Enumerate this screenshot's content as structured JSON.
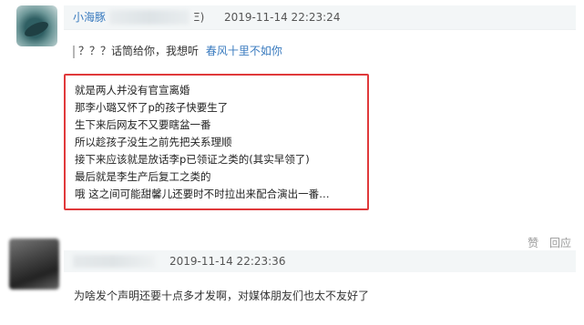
{
  "comment1": {
    "username": "小海豚",
    "username_suffix": "Ξ)",
    "timestamp": "2019-11-14 22:23:24",
    "reply_text": "？？？话筒给你，我想听",
    "reply_link": "春风十里不如你",
    "quote_lines": [
      "就是两人并没有官宣离婚",
      "那李小璐又怀了p的孩子快要生了",
      "生下来后网友不又要瞎盆一番",
      "所以趁孩子没生之前先把关系理顺",
      "接下来应该就是放话李p已领证之类的(其实早领了)",
      "最后就是李生产后复工之类的",
      "哦 这之间可能甜馨儿还要时不时拉出来配合演出一番…"
    ],
    "highlight_color": "#e0393b"
  },
  "actions": {
    "like_label": "赞",
    "reply_label": "回应"
  },
  "comment2": {
    "timestamp": "2019-11-14 22:23:36",
    "text": "为啥发个声明还要十点多才发啊，对媒体朋友们也太不友好了"
  }
}
